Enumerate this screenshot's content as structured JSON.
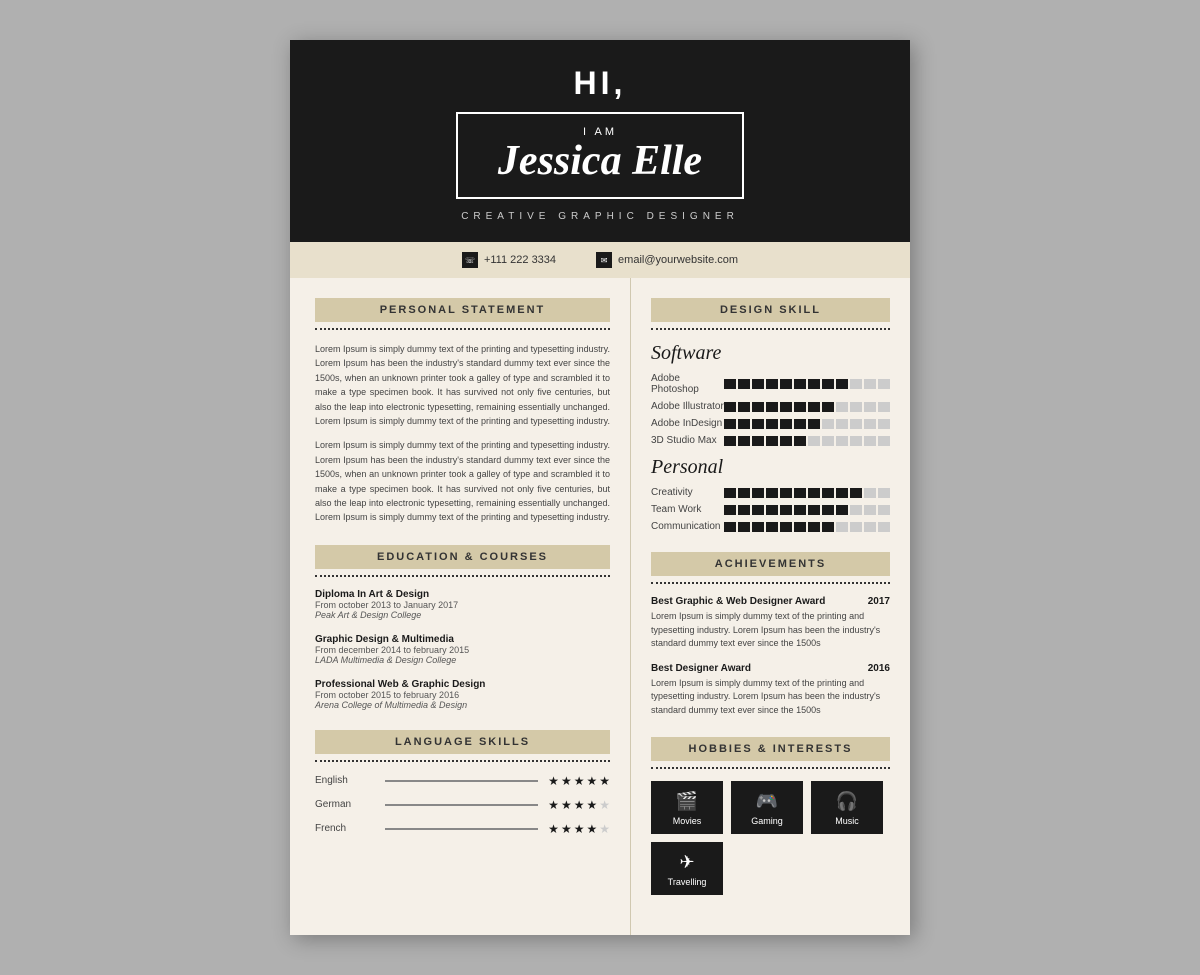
{
  "header": {
    "hi": "HI,",
    "iam": "I AM",
    "name": "Jessica Elle",
    "title": "CREATIVE GRAPHIC DESIGNER"
  },
  "contact": {
    "phone": "+111 222 3334",
    "email": "email@yourwebsite.com"
  },
  "personal_statement": {
    "section_title": "PERSONAL STATEMENT",
    "para1": "Lorem Ipsum is simply dummy text of the printing and typesetting industry. Lorem Ipsum has been the industry's standard dummy text ever since the 1500s, when an unknown printer took a galley of type and scrambled it to make a type specimen book. It has survived not only five centuries, but also the leap into electronic typesetting, remaining essentially unchanged. Lorem Ipsum is simply dummy text of the printing and typesetting industry.",
    "para2": "Lorem Ipsum is simply dummy text of the printing and typesetting industry. Lorem Ipsum has been the industry's standard dummy text ever since the 1500s, when an unknown printer took a galley of type and scrambled it to make a type specimen book. It has survived not only five centuries, but also the leap into electronic typesetting, remaining essentially unchanged. Lorem Ipsum is simply dummy text of the printing and typesetting industry."
  },
  "design_skill": {
    "section_title": "DESIGN SKILL",
    "software_title": "Software",
    "skills_software": [
      {
        "name": "Adobe Photoshop",
        "filled": 9,
        "empty": 3
      },
      {
        "name": "Adobe Illustrator",
        "filled": 8,
        "empty": 4
      },
      {
        "name": "Adobe InDesign",
        "filled": 7,
        "empty": 5
      },
      {
        "name": "3D Studio Max",
        "filled": 6,
        "empty": 6
      }
    ],
    "personal_title": "Personal",
    "skills_personal": [
      {
        "name": "Creativity",
        "filled": 10,
        "empty": 2
      },
      {
        "name": "Team Work",
        "filled": 9,
        "empty": 3
      },
      {
        "name": "Communication",
        "filled": 8,
        "empty": 4
      }
    ]
  },
  "education": {
    "section_title": "EDUCATION & COURSES",
    "entries": [
      {
        "degree": "Diploma In Art & Design",
        "dates": "From october 2013 to January 2017",
        "school": "Peak Art & Design College"
      },
      {
        "degree": "Graphic Design & Multimedia",
        "dates": "From december 2014 to february 2015",
        "school": "LADA Multimedia & Design College"
      },
      {
        "degree": "Professional Web & Graphic Design",
        "dates": "From october 2015 to february 2016",
        "school": "Arena College of Multimedia & Design"
      }
    ]
  },
  "achievements": {
    "section_title": "ACHIEVEMENTS",
    "entries": [
      {
        "title": "Best Graphic & Web Designer Award",
        "year": "2017",
        "text": "Lorem Ipsum is simply dummy text of the printing and typesetting industry. Lorem Ipsum has been the industry's standard dummy text ever since the 1500s"
      },
      {
        "title": "Best Designer Award",
        "year": "2016",
        "text": "Lorem Ipsum is simply dummy text of the printing and typesetting industry. Lorem Ipsum has been the industry's standard dummy text ever since the 1500s"
      }
    ]
  },
  "language_skills": {
    "section_title": "LANGUAGE SKILLS",
    "languages": [
      {
        "name": "English",
        "stars_filled": 5,
        "stars_empty": 0
      },
      {
        "name": "German",
        "stars_filled": 4,
        "stars_empty": 1
      },
      {
        "name": "French",
        "stars_filled": 4,
        "stars_empty": 1
      }
    ]
  },
  "hobbies": {
    "section_title": "HOBBIES & INTERESTS",
    "items": [
      {
        "label": "Movies",
        "icon": "🎬"
      },
      {
        "label": "Gaming",
        "icon": "🎮"
      },
      {
        "label": "Music",
        "icon": "🎧"
      },
      {
        "label": "Travelling",
        "icon": "✈"
      }
    ]
  }
}
